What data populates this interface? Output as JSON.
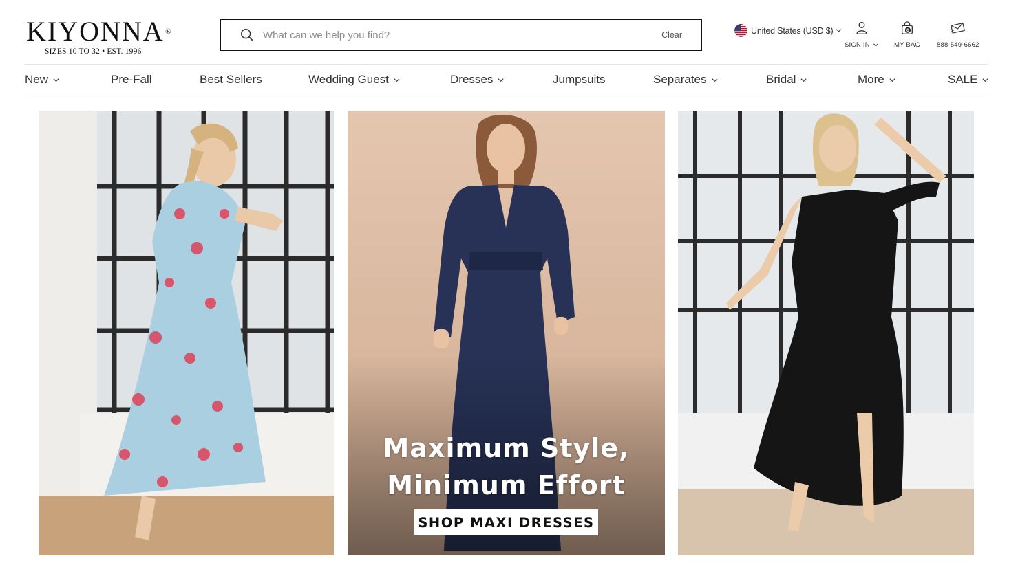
{
  "brand": {
    "name": "KIYONNA",
    "registered": "®",
    "tagline": "SIZES 10 TO 32  •  EST. 1996"
  },
  "search": {
    "placeholder": "What can we help you find?",
    "value": "",
    "clear_label": "Clear"
  },
  "header": {
    "locale": "United States (USD $)",
    "sign_in": "SIGN IN",
    "bag": "MY BAG",
    "bag_count": "0",
    "phone": "888-549-6662"
  },
  "nav": {
    "items": [
      {
        "label": "New",
        "dropdown": true
      },
      {
        "label": "Pre-Fall",
        "dropdown": false
      },
      {
        "label": "Best Sellers",
        "dropdown": false
      },
      {
        "label": "Wedding Guest",
        "dropdown": true
      },
      {
        "label": "Dresses",
        "dropdown": true
      },
      {
        "label": "Jumpsuits",
        "dropdown": false
      },
      {
        "label": "Separates",
        "dropdown": true
      },
      {
        "label": "Bridal",
        "dropdown": true
      },
      {
        "label": "More",
        "dropdown": true
      },
      {
        "label": "SALE",
        "dropdown": true
      }
    ]
  },
  "hero": {
    "headline_line1": "Maximum Style,",
    "headline_line2": "Minimum Effort",
    "cta": "SHOP MAXI DRESSES",
    "panels": [
      {
        "dress": "light-blue floral maxi dress",
        "color": "#aacfe0"
      },
      {
        "dress": "navy long-sleeve maxi dress",
        "color": "#273256"
      },
      {
        "dress": "black ruffle wrap maxi dress",
        "color": "#151515"
      }
    ]
  },
  "colors": {
    "text": "#222222",
    "border": "#111111",
    "divider": "#e6e6e6"
  }
}
